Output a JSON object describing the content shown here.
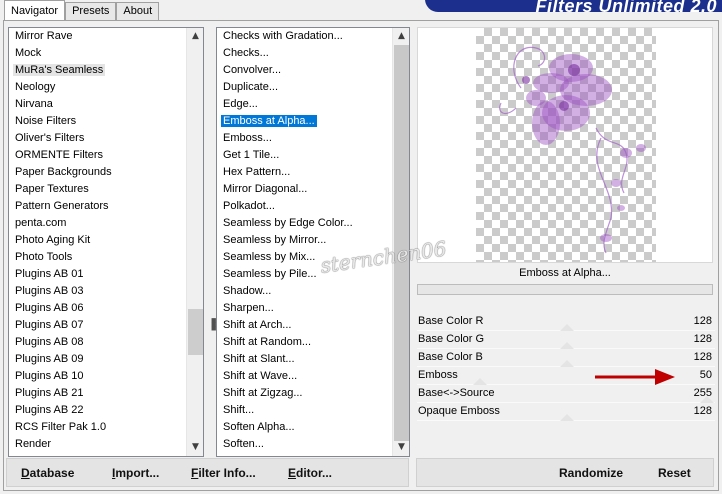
{
  "tabs": [
    "Navigator",
    "Presets",
    "About"
  ],
  "banner": "Filters Unlimited 2.0",
  "categories": [
    "Mirror Rave",
    "Mock",
    "MuRa's Seamless",
    "Neology",
    "Nirvana",
    "Noise Filters",
    "Oliver's Filters",
    "ORMENTE Filters",
    "Paper Backgrounds",
    "Paper Textures",
    "Pattern Generators",
    "penta.com",
    "Photo Aging Kit",
    "Photo Tools",
    "Plugins AB 01",
    "Plugins AB 03",
    "Plugins AB 06",
    "Plugins AB 07",
    "Plugins AB 08",
    "Plugins AB 09",
    "Plugins AB 10",
    "Plugins AB 21",
    "Plugins AB 22",
    "RCS Filter Pak 1.0",
    "Render"
  ],
  "selected_category": "MuRa's Seamless",
  "filters": [
    "Checks with Gradation...",
    "Checks...",
    "Convolver...",
    "Duplicate...",
    "Edge...",
    "Emboss at Alpha...",
    "Emboss...",
    "Get 1 Tile...",
    "Hex Pattern...",
    "Mirror Diagonal...",
    "Polkadot...",
    "Seamless by Edge Color...",
    "Seamless by Mirror...",
    "Seamless by Mix...",
    "Seamless by Pile...",
    "Shadow...",
    "Sharpen...",
    "Shift at Arch...",
    "Shift at Random...",
    "Shift at Slant...",
    "Shift at Wave...",
    "Shift at Zigzag...",
    "Shift...",
    "Soften Alpha...",
    "Soften..."
  ],
  "selected_filter": "Emboss at Alpha...",
  "preview": {
    "filter_name": "Emboss at Alpha...",
    "watermark": "sternchen06"
  },
  "params": [
    {
      "label": "Base Color R",
      "value": "128",
      "level": 128
    },
    {
      "label": "Base Color G",
      "value": "128",
      "level": 128
    },
    {
      "label": "Base Color B",
      "value": "128",
      "level": 128
    },
    {
      "label": "Emboss",
      "value": "50",
      "level": 50
    },
    {
      "label": "Base<->Source",
      "value": "255",
      "level": 255
    },
    {
      "label": "Opaque Emboss",
      "value": "128",
      "level": 128
    }
  ],
  "buttons_left": [
    {
      "label": "Database",
      "accel": "D",
      "rest": "atabase"
    },
    {
      "label": "Import...",
      "accel": "I",
      "rest": "mport..."
    },
    {
      "label": "Filter Info...",
      "accel": "F",
      "rest": "ilter Info..."
    },
    {
      "label": "Editor...",
      "accel": "E",
      "rest": "ditor..."
    }
  ],
  "buttons_right": [
    "Randomize",
    "Reset"
  ],
  "colors": {
    "banner": "#1c2f8c",
    "selection": "#0078d7",
    "arrow": "#c00000",
    "flower": "#9b4fc0"
  }
}
